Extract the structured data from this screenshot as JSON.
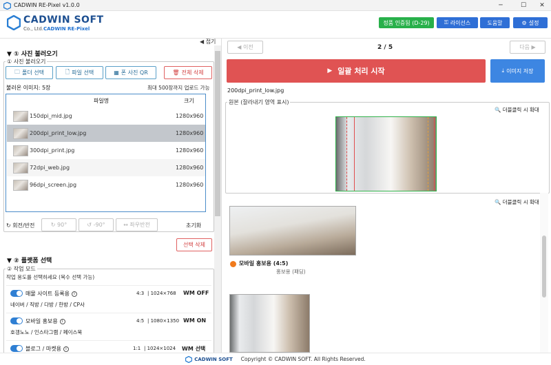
{
  "window": {
    "title": "CADWIN RE-Pixel v1.0.0",
    "min": "─",
    "max": "☐",
    "close": "✕"
  },
  "header": {
    "logo_title": "CADWIN SOFT",
    "logo_co": "Co., Ltd.",
    "logo_product": "CADWIN RE-Pixel",
    "trial_badge": "정품 인증됨 (D-29)",
    "license_button": "라이선스",
    "help_button": "도움말",
    "settings_button": "설정",
    "colors": {
      "badge": "#28b04a",
      "button": "#2f6fd6"
    }
  },
  "left": {
    "collapse": "◀ 접기",
    "section1_title": "▼ ① 사진 불러오기",
    "group1_label": "① 사진 불러오기",
    "btn_folder": "폴더 선택",
    "btn_file": "파일 선택",
    "btn_qr": "폰 사진 QR",
    "btn_delete_all": "전체 삭제",
    "loaded_count": "불러온 이미지: 5장",
    "max_upload": "최대 500장까지 업로드 가능",
    "col_filename": "파일명",
    "col_size": "크기",
    "files": [
      {
        "name": "150dpi_mid.jpg",
        "size": "1280x960"
      },
      {
        "name": "200dpi_print_low.jpg",
        "size": "1280x960"
      },
      {
        "name": "300dpi_print.jpg",
        "size": "1280x960"
      },
      {
        "name": "72dpi_web.jpg",
        "size": "1280x960"
      },
      {
        "name": "96dpi_screen.jpg",
        "size": "1280x960"
      }
    ],
    "rotate_label": "회전/반전",
    "rot_cw": "↻ 90°",
    "rot_ccw": "↺ -90°",
    "flip": "↔ 좌우반전",
    "reset": "초기화",
    "delete_selected": "선택 삭제",
    "section2_title": "▼ ② 플랫폼 선택",
    "group2_label": "② 작업 모드",
    "mode_hint": "작업 용도를 선택하세요 (복수 선택 가능)",
    "modes": [
      {
        "name": "매물 사이트 등록용",
        "ratio": "4:3",
        "res": "1024×768",
        "wm": "WM OFF",
        "sub": "네이버 / 직방 / 다방 / 한방 / CP사"
      },
      {
        "name": "모바일 홍보용",
        "ratio": "4:5",
        "res": "1080×1350",
        "wm": "WM ON",
        "sub": "호갱노노 / 인스타그램 / 페이스북"
      },
      {
        "name": "블로그 / 마켓용",
        "ratio": "1:1",
        "res": "1024×1024",
        "wm": "WM 선택",
        "sub": ""
      }
    ]
  },
  "right": {
    "prev": "◀ 이전",
    "page": "2 / 5",
    "next": "다음 ▶",
    "batch_button": "일괄 처리 시작",
    "save_button": "이미지 저장",
    "current_file": "200dpi_print_low.jpg",
    "original_label": "원본 (잘라내기 영역 표시)",
    "dblclick_zoom": "더블클릭 시 확대",
    "result_title": "모바일 홍보용 (4:5)",
    "result_sub": "홍보용 (패딩)",
    "colors": {
      "batch": "#e05353",
      "save": "#3d86e2",
      "marker": "#f07a1c"
    }
  },
  "footer": {
    "logo": "CADWIN SOFT",
    "copyright": "Copyright © CADWIN SOFT. All Rights Reserved."
  }
}
